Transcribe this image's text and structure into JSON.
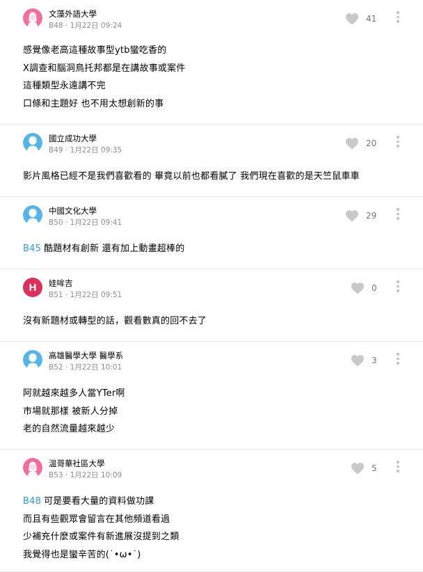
{
  "comments": [
    {
      "school": "文藻外語大學",
      "floor": "B48",
      "date": "1月22日 09:24",
      "likes": "41",
      "avatar": "female",
      "avatar_color": "#f06f9c",
      "lines": [
        "感覺像老高這種故事型ytb蠻吃香的",
        "X調查和腦洞鳥托邦都是在講故事或案件",
        "這種類型永遠講不完",
        "口條和主題好 也不用太想創新的事"
      ]
    },
    {
      "school": "國立成功大學",
      "floor": "B49",
      "date": "1月22日 09:35",
      "likes": "20",
      "avatar": "male",
      "avatar_color": "#58b4e6",
      "lines": [
        "影片風格已經不是我們喜歡看的 畢竟以前也都看膩了 我們現在喜歡的是天竺鼠車車"
      ]
    },
    {
      "school": "中國文化大學",
      "floor": "B50",
      "date": "1月22日 09:41",
      "likes": "29",
      "avatar": "male",
      "avatar_color": "#58b4e6",
      "reply_ref": "B45",
      "lines": [
        "酷題材有創新 還有加上動畫超棒的"
      ]
    },
    {
      "school": "娃哞吉",
      "floor": "B51",
      "date": "1月22日 09:51",
      "likes": "0",
      "avatar": "letter",
      "avatar_letter": "H",
      "avatar_color": "#d6325d",
      "lines": [
        "沒有新題材或轉型的話，觀看數真的回不去了"
      ]
    },
    {
      "school": "高雄醫學大學 醫學系",
      "floor": "B52",
      "date": "1月22日 10:01",
      "likes": "3",
      "avatar": "male",
      "avatar_color": "#58b4e6",
      "lines": [
        "阿就越來越多人當YTer啊",
        "市場就那樣 被新人分掉",
        "老的自然流量越來越少"
      ]
    },
    {
      "school": "溫哥華社區大學",
      "floor": "B53",
      "date": "1月22日 10:09",
      "likes": "5",
      "avatar": "female",
      "avatar_color": "#f06f9c",
      "reply_ref": "B48",
      "lines": [
        "可是要看大量的資料做功課",
        "而且有些觀眾會留言在其他頻道看過",
        "少補充什麼或案件有新進展沒提到之類",
        "我覺得也是蠻辛苦的(˙•ω•˙)"
      ]
    }
  ],
  "icons": {
    "like": "heart-icon",
    "more": "more-vertical-icon",
    "avatar_female": "female-avatar-icon",
    "avatar_male": "male-avatar-icon"
  },
  "colors": {
    "reply_link": "#3397cf",
    "heart": "#c9c9c9",
    "divider": "#e9e9e9"
  }
}
